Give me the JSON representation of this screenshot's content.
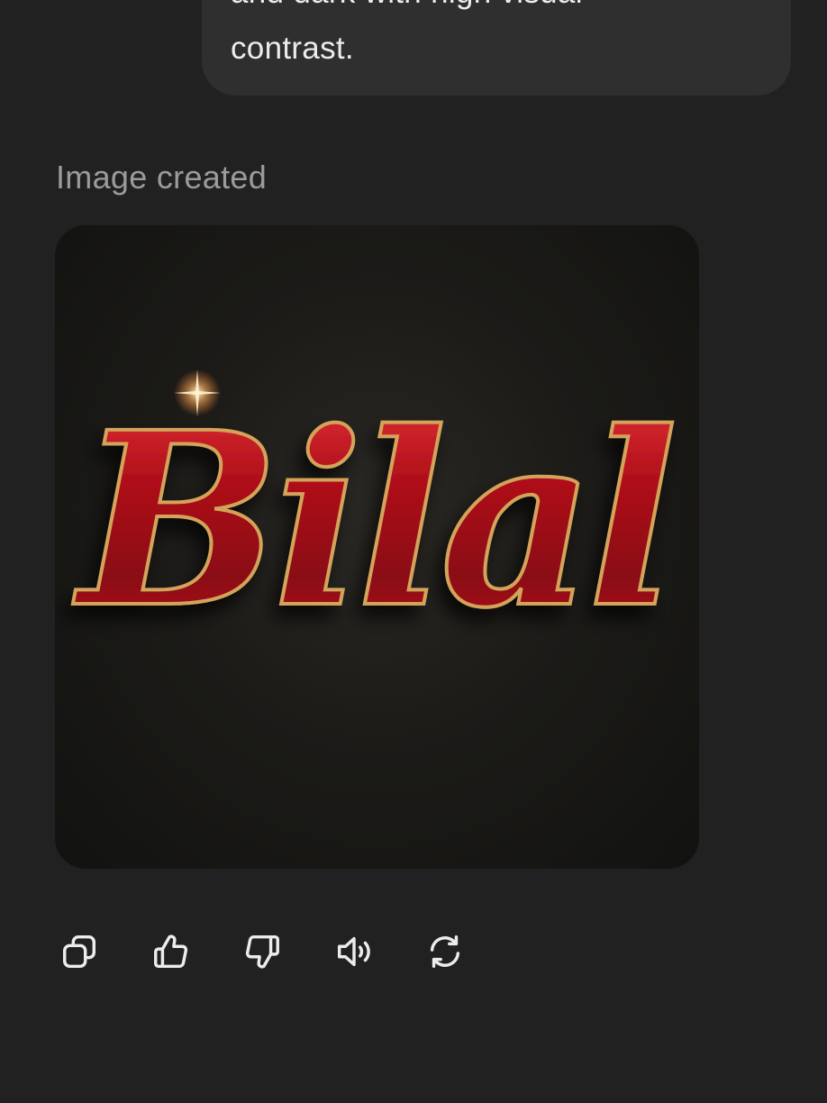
{
  "user_message": {
    "line1": "and dark with high visual",
    "line2": "contrast."
  },
  "assistant": {
    "status": "Image created",
    "image": {
      "text": "Bilal",
      "style": "gothic blackletter, ruby red with gold outline",
      "colors": {
        "background": "#1a1916",
        "letter_fill": "#b0101a",
        "letter_highlight": "#e8343a",
        "outline": "#d4a35a"
      }
    },
    "actions": [
      {
        "name": "copy",
        "icon": "copy-icon"
      },
      {
        "name": "good-response",
        "icon": "thumbs-up-icon"
      },
      {
        "name": "bad-response",
        "icon": "thumbs-down-icon"
      },
      {
        "name": "read-aloud",
        "icon": "speaker-icon"
      },
      {
        "name": "regenerate",
        "icon": "refresh-icon"
      }
    ]
  },
  "theme": {
    "background": "#212121",
    "bubble": "#2f2f2f",
    "text": "#ececec",
    "muted": "#9b9b9b"
  }
}
